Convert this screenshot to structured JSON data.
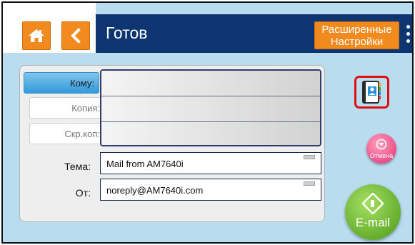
{
  "header": {
    "status_title": "Готов",
    "advanced_settings_label": "Расширенные Настройки",
    "home_icon": "home-icon",
    "back_icon": "chevron-left-icon",
    "menu_icon": "kebab-menu-icon"
  },
  "recipients": {
    "to_label": "Кому:",
    "cc_label": "Копия:",
    "bcc_label": "Скр.коп:",
    "to_value": "",
    "cc_value": "",
    "bcc_value": ""
  },
  "fields": {
    "subject_label": "Тема:",
    "subject_value": "Mail from AM7640i",
    "from_label": "От:",
    "from_value": "noreply@AM7640i.com"
  },
  "actions": {
    "cancel_label": "Отмена",
    "email_label": "E-mail",
    "address_book_icon": "address-book-icon"
  },
  "colors": {
    "orange": "#f28a1e",
    "navy": "#0d3571",
    "background": "#b9dcef",
    "cancel_pink": "#e2306e",
    "email_green": "#5aa822",
    "highlight_red": "#e01010"
  }
}
